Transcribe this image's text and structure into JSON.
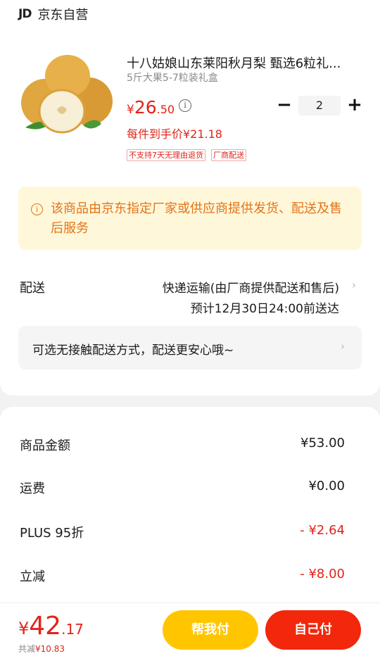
{
  "store": {
    "logo": "JD",
    "name": "京东自营"
  },
  "product": {
    "title": "十八姑娘山东莱阳秋月梨 甄选6粒礼...",
    "spec": "5斤大果5-7粒装礼盒",
    "price_currency": "¥",
    "price_int": "26",
    "price_dec": ".50",
    "final_price": "每件到手价¥21.18",
    "quantity": "2",
    "tags": [
      "不支持7天无理由退货",
      "厂商配送"
    ],
    "image_icon": "pear-fruit-image"
  },
  "notice": {
    "text": "该商品由京东指定厂家或供应商提供发货、配送及售后服务"
  },
  "delivery": {
    "label": "配送",
    "method": "快递运输(由厂商提供配送和售后)",
    "eta": "预计12月30日24:00前送达",
    "contactless": "可选无接触配送方式，配送更安心哦~"
  },
  "summary": [
    {
      "label": "商品金额",
      "value": "¥53.00",
      "red": false
    },
    {
      "label": "运费",
      "value": "¥0.00",
      "red": false
    },
    {
      "label": "PLUS 95折",
      "value": "- ¥2.64",
      "red": true
    },
    {
      "label": "立减",
      "value": "- ¥8.00",
      "red": true
    }
  ],
  "bottom": {
    "currency": "¥",
    "total_int": "42",
    "total_dec": ".17",
    "saved_label": "共减",
    "saved_value": "¥10.83",
    "help_pay": "帮我付",
    "self_pay": "自己付"
  },
  "colors": {
    "accent_red": "#e2231a",
    "yellow": "#ffc600",
    "notice_orange": "#e2741a"
  }
}
